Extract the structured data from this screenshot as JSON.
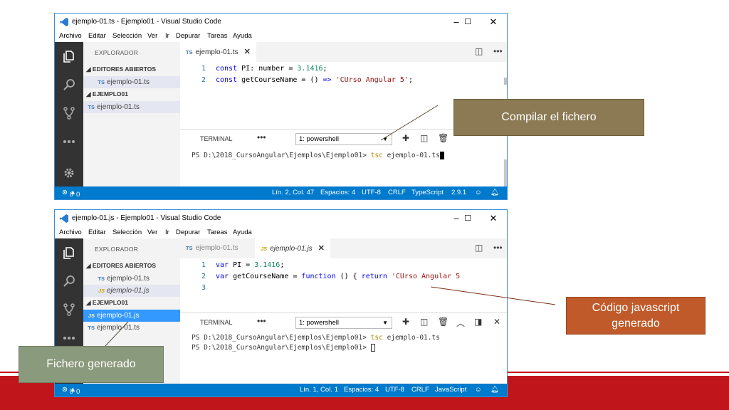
{
  "window1": {
    "title": "ejemplo-01.ts - Ejemplo01 - Visual Studio Code",
    "menu": [
      "Archivo",
      "Editar",
      "Selección",
      "Ver",
      "Ir",
      "Depurar",
      "Tareas",
      "Ayuda"
    ],
    "explorer_header": "EXPLORADOR",
    "open_editors_label": "EDITORES ABIERTOS",
    "open_editors": [
      {
        "icon": "TS",
        "name": "ejemplo-01.ts"
      }
    ],
    "folder_label": "EJEMPLO01",
    "folder_files": [
      {
        "icon": "TS",
        "name": "ejemplo-01.ts"
      }
    ],
    "tab": {
      "icon": "TS",
      "name": "ejemplo-01.ts",
      "close": "✕"
    },
    "code": [
      {
        "line": "1",
        "parts": [
          {
            "t": "kw",
            "v": "const "
          },
          {
            "t": "tx",
            "v": "PI: number = "
          },
          {
            "t": "num",
            "v": "3.1416"
          },
          {
            "t": "tx",
            "v": ";"
          }
        ]
      },
      {
        "line": "2",
        "parts": [
          {
            "t": "kw",
            "v": "const "
          },
          {
            "t": "tx",
            "v": "getCourseName = () "
          },
          {
            "t": "kw",
            "v": "=>"
          },
          {
            "t": "tx",
            "v": " "
          },
          {
            "t": "str",
            "v": "'CUrso Angular 5'"
          },
          {
            "t": "tx",
            "v": ";"
          }
        ]
      }
    ],
    "terminal": {
      "label": "TERMINAL",
      "shell": "1: powershell",
      "lines": [
        {
          "prompt": "PS D:\\2018_CursoAngular\\Ejemplos\\Ejemplo01> ",
          "cmd": "tsc",
          "rest": " ejemplo-01.ts"
        }
      ]
    },
    "status": {
      "errors": "0",
      "warnings": "0",
      "position": "Lín. 2, Col. 47",
      "spaces": "Espacios: 4",
      "encoding": "UTF-8",
      "eol": "CRLF",
      "language": "TypeScript",
      "version": "2.9.1"
    }
  },
  "window2": {
    "title": "ejemplo-01.js - Ejemplo01 - Visual Studio Code",
    "menu": [
      "Archivo",
      "Editar",
      "Selección",
      "Ver",
      "Ir",
      "Depurar",
      "Tareas",
      "Ayuda"
    ],
    "explorer_header": "EXPLORADOR",
    "open_editors_label": "EDITORES ABIERTOS",
    "open_editors": [
      {
        "icon": "TS",
        "name": "ejemplo-01.ts"
      },
      {
        "icon": "JS",
        "name": "ejemplo-01.js"
      }
    ],
    "folder_label": "EJEMPLO01",
    "folder_files": [
      {
        "icon": "JS",
        "name": "ejemplo-01.js"
      },
      {
        "icon": "TS",
        "name": "ejemplo-01.ts"
      }
    ],
    "tabs": [
      {
        "icon": "TS",
        "name": "ejemplo-01.ts"
      },
      {
        "icon": "JS",
        "name": "ejemplo-01.js",
        "close": "✕"
      }
    ],
    "code": [
      {
        "line": "1",
        "parts": [
          {
            "t": "kw",
            "v": "var "
          },
          {
            "t": "tx",
            "v": "PI = "
          },
          {
            "t": "num",
            "v": "3.1416"
          },
          {
            "t": "tx",
            "v": ";"
          }
        ]
      },
      {
        "line": "2",
        "parts": [
          {
            "t": "kw",
            "v": "var "
          },
          {
            "t": "tx",
            "v": "getCourseName = "
          },
          {
            "t": "kw",
            "v": "function"
          },
          {
            "t": "tx",
            "v": " () { "
          },
          {
            "t": "kw",
            "v": "return"
          },
          {
            "t": "tx",
            "v": " "
          },
          {
            "t": "str",
            "v": "'CUrso Angular 5"
          }
        ]
      },
      {
        "line": "3",
        "parts": []
      }
    ],
    "terminal": {
      "label": "TERMINAL",
      "shell": "1: powershell",
      "lines": [
        {
          "prompt": "PS D:\\2018_CursoAngular\\Ejemplos\\Ejemplo01> ",
          "cmd": "tsc",
          "rest": " ejemplo-01.ts"
        },
        {
          "prompt": "PS D:\\2018_CursoAngular\\Ejemplos\\Ejemplo01> ",
          "cmd": "",
          "rest": ""
        }
      ]
    },
    "status": {
      "errors": "0",
      "warnings": "0",
      "position": "Lín. 1, Col. 1",
      "spaces": "Espacios: 4",
      "encoding": "UTF-8",
      "eol": "CRLF",
      "language": "JavaScript"
    }
  },
  "callouts": {
    "compile": "Compilar el fichero",
    "code_line1": "Código javascript",
    "code_line2": "generado",
    "file": "Fichero generado"
  },
  "colors": {
    "accent": "#007acc",
    "band": "#c0161b",
    "compile_box": "#8c7a55",
    "code_box": "#c05a2a",
    "file_box": "#8a9a7c"
  },
  "icons": [
    "vscode-logo-icon",
    "explorer-icon",
    "search-icon",
    "source-control-icon",
    "more-icon",
    "gear-icon",
    "split-editor-icon",
    "plus-icon",
    "trash-icon",
    "smiley-icon",
    "bell-icon",
    "error-icon",
    "warning-icon",
    "minimize-icon",
    "maximize-icon",
    "close-icon"
  ]
}
